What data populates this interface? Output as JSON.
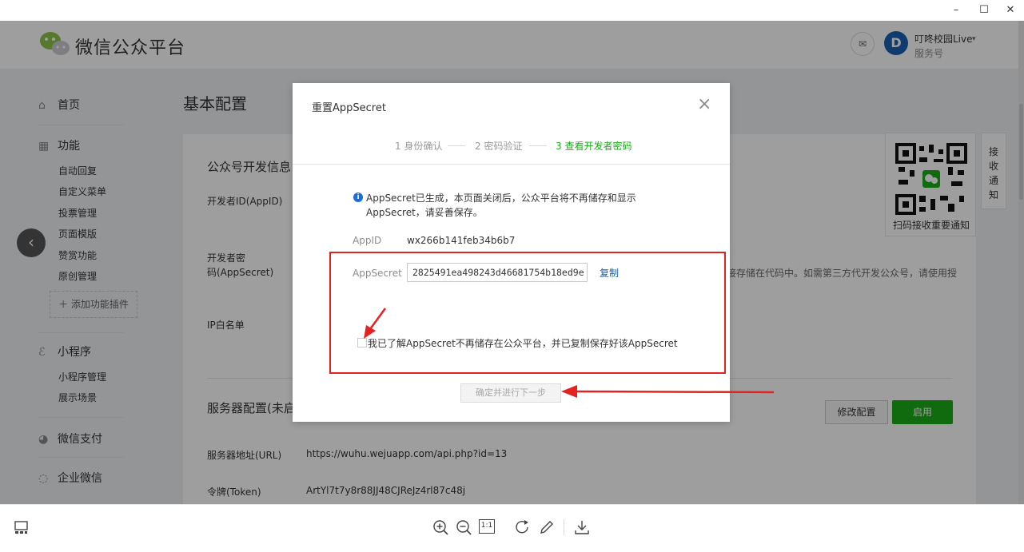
{
  "window": {
    "minimize": "–",
    "maximize": "☐",
    "close": "✕"
  },
  "header": {
    "app_title": "微信公众平台",
    "account_name": "叮咚校园Live",
    "account_type": "服务号"
  },
  "sidebar": {
    "home": "首页",
    "features": "功能",
    "feature_items": [
      "自动回复",
      "自定义菜单",
      "投票管理",
      "页面模版",
      "赞赏功能",
      "原创管理"
    ],
    "add_plugin": "添加功能插件",
    "mini_program": "小程序",
    "mini_items": [
      "小程序管理",
      "展示场景"
    ],
    "wechat_pay": "微信支付",
    "enterprise_wechat": "企业微信"
  },
  "main": {
    "title": "基本配置",
    "dev_info_heading": "公众号开发信息",
    "appid_label": "开发者ID(AppID)",
    "secret_label_1": "开发者密",
    "secret_label_2": "码(AppSecret)",
    "ip_label": "IP白名单",
    "side_note": "接存储在代码中。如需第三方代开发公众号，请使用授",
    "server_heading": "服务器配置(未启",
    "url_label": "服务器地址(URL)",
    "url_value": "https://wuhu.wejuapp.com/api.php?id=13",
    "token_label": "令牌(Token)",
    "token_value": "ArtYl7t7y8r88JJ48CJReJz4rl87c48j",
    "modify_button": "修改配置",
    "enable_button": "启用",
    "qr_caption": "扫码接收重要通知",
    "notify_tab": "接收通知"
  },
  "modal": {
    "title": "重置AppSecret",
    "steps": [
      "1 身份确认",
      "2 密码验证",
      "3 查看开发者密码"
    ],
    "active_step": 2,
    "info": "AppSecret已生成，本页面关闭后，公众平台将不再储存和显示AppSecret，请妥善保存。",
    "appid_label": "AppID",
    "appid_value": "wx266b141feb34b6b7",
    "secret_label": "AppSecret",
    "secret_value": "2825491ea498243d46681754b18ed9e",
    "copy_link": "复制",
    "checkbox_text": "我已了解AppSecret不再储存在公众平台，并已复制保存好该AppSecret",
    "confirm_button": "确定并进行下一步"
  },
  "toolbar": {
    "fit_label": "1:1"
  },
  "colors": {
    "brand_green": "#1aad19",
    "link_blue": "#1c5ea8",
    "annotation_red": "#e52222"
  }
}
